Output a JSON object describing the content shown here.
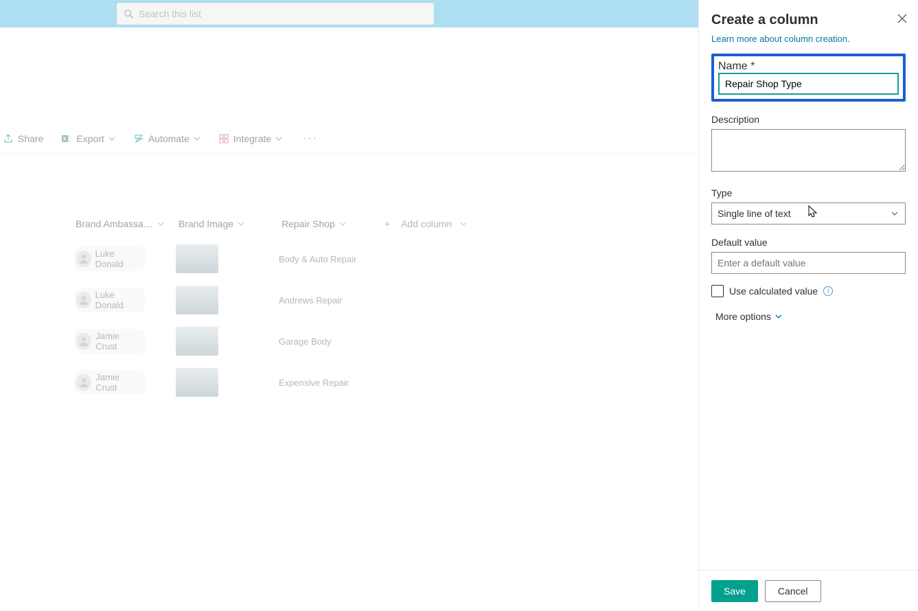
{
  "search": {
    "placeholder": "Search this list"
  },
  "commands": {
    "share": "Share",
    "export": "Export",
    "automate": "Automate",
    "integrate": "Integrate"
  },
  "columns": {
    "ambassador": "Brand Ambassa…",
    "image": "Brand Image",
    "shop": "Repair Shop",
    "add": "Add column"
  },
  "rows": [
    {
      "name": "Luke Donald",
      "shop": "Body & Auto Repair"
    },
    {
      "name": "Luke Donald",
      "shop": "Andrews Repair"
    },
    {
      "name": "Jamie Crust",
      "shop": "Garage Body"
    },
    {
      "name": "Jamie Crust",
      "shop": "Expensive Repair"
    }
  ],
  "panel": {
    "title": "Create a column",
    "learn": "Learn more about column creation.",
    "name_label": "Name *",
    "name_value": "Repair Shop Type",
    "desc_label": "Description",
    "type_label": "Type",
    "type_value": "Single line of text",
    "default_label": "Default value",
    "default_placeholder": "Enter a default value",
    "calc_label": "Use calculated value",
    "more": "More options",
    "save": "Save",
    "cancel": "Cancel"
  }
}
